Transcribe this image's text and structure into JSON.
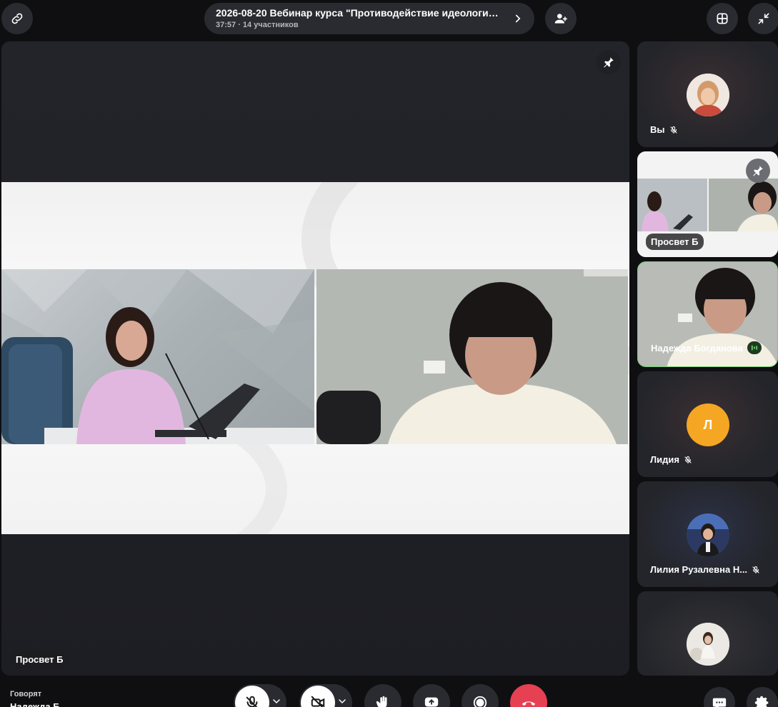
{
  "meeting": {
    "title": "2026-08-20 Вебинар курса \"Противодействие идеологии ...",
    "timer": "37:57",
    "participants": "14 участников"
  },
  "stage": {
    "label": "Просвет Б"
  },
  "sidebar": {
    "tiles": [
      {
        "name": "Вы",
        "muted": true
      },
      {
        "name": "Просвет Б",
        "pinned": true
      },
      {
        "name": "Надежда Богданова",
        "speaking": true
      },
      {
        "name": "Лидия",
        "initial": "Л",
        "muted": true
      },
      {
        "name": "Лилия Рузалевна Н...",
        "muted": true
      },
      {
        "name": ""
      }
    ]
  },
  "bottom": {
    "speaking_label": "Говорят",
    "speaking_name": "Надежда Б"
  },
  "colors": {
    "accent_end_call": "#e64053",
    "speaking_border": "#6fd36f",
    "avatar_initial_bg": "#f5a623"
  }
}
